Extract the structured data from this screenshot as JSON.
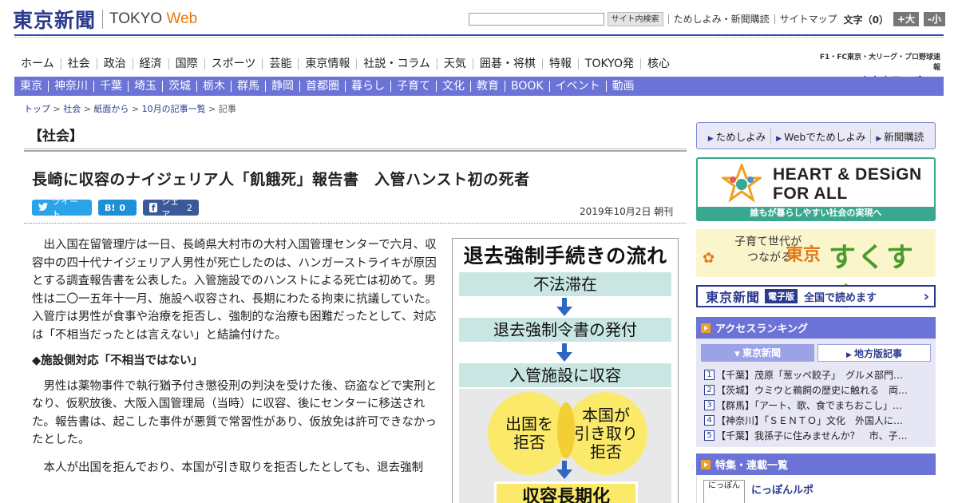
{
  "header": {
    "logo_jp": "東京新聞",
    "logo_en_prefix": "TOKYO",
    "logo_en_suffix": "Web",
    "search_button": "サイト内検索",
    "links": [
      "ためしよみ・新聞購読",
      "サイトマップ"
    ],
    "font_label": "文字（0）",
    "font_bigger": "+大",
    "font_smaller": "-小"
  },
  "nav_primary": [
    "ホーム",
    "社会",
    "政治",
    "経済",
    "国際",
    "スポーツ",
    "芸能",
    "東京情報",
    "社説・コラム",
    "天気",
    "囲碁・将棋",
    "特報",
    "TOKYO発",
    "核心"
  ],
  "sports_link": {
    "top": "F1・FC東京・大リーグ・プロ野球速報",
    "logo": "東京中日スポーツ"
  },
  "nav_secondary": [
    "東京",
    "神奈川",
    "千葉",
    "埼玉",
    "茨城",
    "栃木",
    "群馬",
    "静岡",
    "首都圏",
    "暮らし",
    "子育て",
    "文化",
    "教育",
    "BOOK",
    "イベント",
    "動画"
  ],
  "breadcrumb": {
    "items": [
      "トップ",
      "社会",
      "紙面から",
      "10月の記事一覧"
    ],
    "current": "記事",
    "separator": " > "
  },
  "article": {
    "section": "【社会】",
    "headline": "長崎に収容のナイジェリア人「飢餓死」報告書　入管ハンスト初の死者",
    "date": "2019年10月2日 朝刊",
    "paragraph1": "出入国在留管理庁は一日、長崎県大村市の大村入国管理センターで六月、収容中の四十代ナイジェリア人男性が死亡したのは、ハンガーストライキが原因とする調査報告書を公表した。入管施設でのハンストによる死亡は初めて。男性は二〇一五年十一月、施設へ収容され、長期にわたる拘束に抗議していた。入管庁は男性が食事や治療を拒否し、強制的な治療も困難だったとして、対応は「不相当だったとは言えない」と結論付けた。",
    "subhead": "◆施設側対応「不相当ではない」",
    "paragraph2": "男性は薬物事件で執行猶予付き懲役刑の判決を受けた後、窃盗などで実刑となり、仮釈放後、大阪入国管理局（当時）に収容、後にセンターに移送された。報告書は、起こした事件が悪質で常習性があり、仮放免は許可できなかったとした。",
    "paragraph3": "本人が出国を拒んでおり、本国が引き取りを拒否したとしても、退去強制"
  },
  "social": {
    "tweet": "ツイート",
    "hatena_icon": "B!",
    "hatena_count": "0",
    "facebook_icon": "f",
    "share_label": "シェア",
    "share_count": "2"
  },
  "figure": {
    "title": "退去強制手続きの流れ",
    "step1": "不法滞在",
    "step2": "退去強制令書の発付",
    "step3": "入管施設に収容",
    "left_circle": "出国を\n拒否",
    "right_circle": "本国が\n引き取り\n拒否",
    "result": "収容長期化"
  },
  "sidebar": {
    "subscribe_links": [
      "ためしよみ",
      "Webでためしよみ",
      "新聞購読"
    ],
    "heart_design": {
      "title_line1": "HEART & DESiGN",
      "title_line2": "FOR ALL",
      "footer": "誰もが暮らしやすい社会の実現へ"
    },
    "sukusuku": {
      "line1": "子育て世代が",
      "line2": "つながる",
      "tokyo": "東京",
      "big": "すくすく"
    },
    "digital": {
      "logo": "東京新聞",
      "tag": "電子版",
      "text": "全国で読めます"
    },
    "ranking": {
      "title": "アクセスランキング",
      "tabs": [
        "東京新聞",
        "地方版記事"
      ],
      "items": [
        "【千葉】茂原「葱ッペ餃子」　グルメ部門…",
        "【茨城】ウミウと鵜飼の歴史に触れる　両…",
        "【群馬】「アート、歌、食でまちおこし」…",
        "【神奈川】「ＳＥＮＴＯ」文化　外国人に…",
        "【千葉】我孫子に住みませんか？　市、子…"
      ]
    },
    "features": {
      "title": "特集・連載一覧",
      "first_thumb": "にっぽん",
      "first_title": "にっぽんルポ"
    }
  },
  "colors": {
    "brand_blue": "#2b3a8f",
    "nav_bar": "#6b73d6",
    "accent_orange": "#e8780a",
    "heart_green": "#3aa890",
    "figure_yellow": "#fbea6a",
    "figure_teal": "#c9e6e2"
  }
}
